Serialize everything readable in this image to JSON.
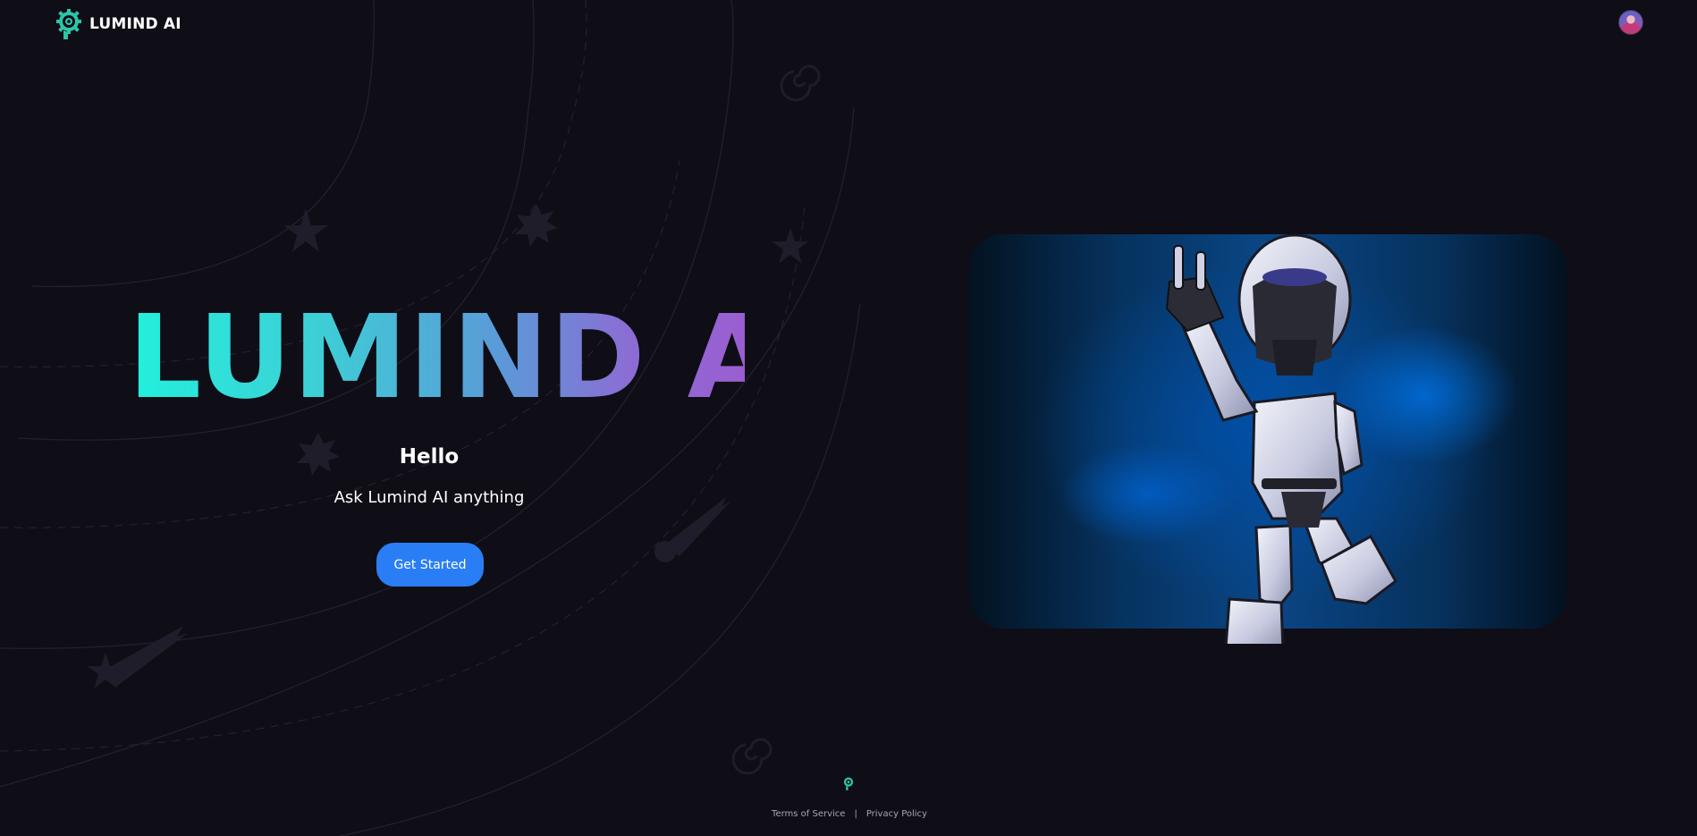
{
  "header": {
    "brand_name": "LUMIND AI",
    "logo_icon": "brain-gear-icon",
    "avatar_icon": "user-avatar"
  },
  "hero": {
    "title": "LUMIND AI",
    "greeting": "Hello",
    "subtitle": "Ask Lumind AI anything",
    "cta_label": "Get Started",
    "image": "robot-peace-sign-image"
  },
  "footer": {
    "logo_icon": "brain-gear-icon",
    "links": [
      "Terms of Service",
      "Privacy Policy"
    ],
    "separator": "|"
  },
  "colors": {
    "background": "#0f0d16",
    "accent_button": "#2a7ef5",
    "title_gradient_start": "#22f0dc",
    "title_gradient_end": "#9a5ed0",
    "logo_teal": "#2ec4a6"
  }
}
